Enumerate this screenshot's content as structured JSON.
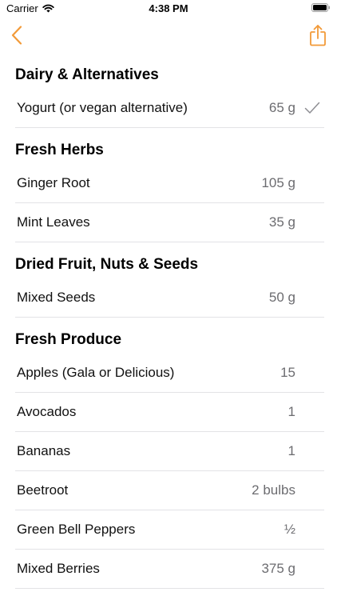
{
  "status_bar": {
    "carrier": "Carrier",
    "time": "4:38 PM"
  },
  "nav": {
    "back_icon": "chevron-left-icon",
    "share_icon": "share-icon",
    "accent_color": "#f29a38"
  },
  "sections": [
    {
      "title": "Dairy & Alternatives",
      "items": [
        {
          "name": "Yogurt (or vegan alternative)",
          "qty": "65 g",
          "checked": true
        }
      ]
    },
    {
      "title": "Fresh Herbs",
      "items": [
        {
          "name": "Ginger Root",
          "qty": "105 g",
          "checked": false
        },
        {
          "name": "Mint Leaves",
          "qty": "35 g",
          "checked": false
        }
      ]
    },
    {
      "title": "Dried Fruit, Nuts & Seeds",
      "items": [
        {
          "name": "Mixed Seeds",
          "qty": "50 g",
          "checked": false
        }
      ]
    },
    {
      "title": "Fresh Produce",
      "items": [
        {
          "name": "Apples (Gala or Delicious)",
          "qty": "15",
          "checked": false
        },
        {
          "name": "Avocados",
          "qty": "1",
          "checked": false
        },
        {
          "name": "Bananas",
          "qty": "1",
          "checked": false
        },
        {
          "name": "Beetroot",
          "qty": "2 bulbs",
          "checked": false
        },
        {
          "name": "Green Bell Peppers",
          "qty": "½",
          "checked": false
        },
        {
          "name": "Mixed Berries",
          "qty": "375 g",
          "checked": false
        }
      ]
    }
  ]
}
